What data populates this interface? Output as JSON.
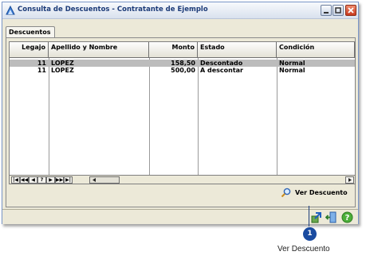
{
  "window": {
    "title": "Consulta de Descuentos - Contratante de Ejemplo",
    "app_icon": "app-logo-icon",
    "controls": [
      "minimize-icon",
      "maximize-icon",
      "close-icon"
    ]
  },
  "tabs": [
    {
      "label": "Descuentos",
      "active": true
    }
  ],
  "table": {
    "columns": [
      "Legajo",
      "Apellido y Nombre",
      "Monto",
      "Estado",
      "Condición"
    ],
    "rows": [
      {
        "legajo": "11",
        "nombre": "LOPEZ",
        "monto": "158,50",
        "estado": "Descontado",
        "condicion": "Normal",
        "selected": true
      },
      {
        "legajo": "11",
        "nombre": "LOPEZ",
        "monto": "500,00",
        "estado": "A descontar",
        "condicion": "Normal",
        "selected": false
      }
    ]
  },
  "navigator": {
    "buttons": [
      "|◀",
      "◀◀",
      "◀",
      "?",
      "▶",
      "▶▶",
      "▶|"
    ]
  },
  "actions": {
    "ver_descuento": "Ver Descuento",
    "ver_icon": "magnifier-icon"
  },
  "status_icons": [
    "export-icon",
    "exit-door-icon",
    "help-icon"
  ],
  "annotation": {
    "badge": "1",
    "caption": "Ver Descuento"
  },
  "colors": {
    "accent": "#1a4ba0",
    "selected_row": "#bcbcbc",
    "window_bg": "#ece9d8"
  }
}
